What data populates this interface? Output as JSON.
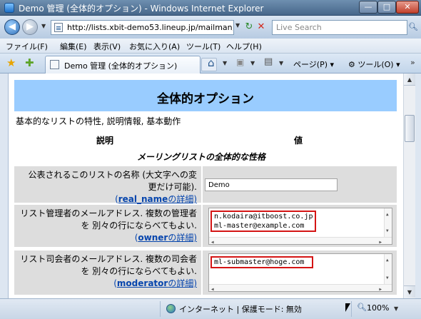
{
  "window": {
    "title": "Demo 管理 (全体的オプション) - Windows Internet Explorer",
    "minimize": "—",
    "maximize": "□",
    "close": "✕"
  },
  "address_bar": {
    "url": "http://lists.xbit-demo53.lineup.jp/mailman/",
    "search_placeholder": "Live Search"
  },
  "menu": [
    "ファイル(F)",
    "編集(E)",
    "表示(V)",
    "お気に入り(A)",
    "ツール(T)",
    "ヘルプ(H)"
  ],
  "tab": {
    "label": "Demo 管理 (全体的オプション)"
  },
  "command_bar": {
    "page": "ページ(P)",
    "tools": "ツール(O)"
  },
  "page": {
    "heading": "全体的オプション",
    "subtitle": "基本的なリストの特性, 説明情報, 基本動作",
    "column_description": "説明",
    "column_value": "値",
    "section_title": "メーリングリストの全体的な性格",
    "rows": [
      {
        "label": "公表されるこのリストの名称 (大文字への変更だけ可能).",
        "link_prefix": "(",
        "link_key": "real_name",
        "link_suffix": "の詳細)",
        "value": "Demo"
      },
      {
        "label": "リスト管理者のメールアドレス. 複数の管理者を 別々の行にならべてもよい.",
        "link_prefix": "(",
        "link_key": "owner",
        "link_suffix": "の詳細)",
        "value": "n.kodaira@itboost.co.jp\nml-master@example.com"
      },
      {
        "label": "リスト司会者のメールアドレス. 複数の司会者を 別々の行にならべてもよい.",
        "link_prefix": "(",
        "link_key": "moderator",
        "link_suffix": "の詳細)",
        "value": "ml-submaster@hoge.com"
      }
    ]
  },
  "status_bar": {
    "zone": "インターネット | 保護モード: 無効",
    "zoom": "100%"
  },
  "colors": {
    "header_band": "#99ccff",
    "row_background": "#dddddd",
    "highlight_border": "#d41414",
    "link": "#0645ad"
  }
}
